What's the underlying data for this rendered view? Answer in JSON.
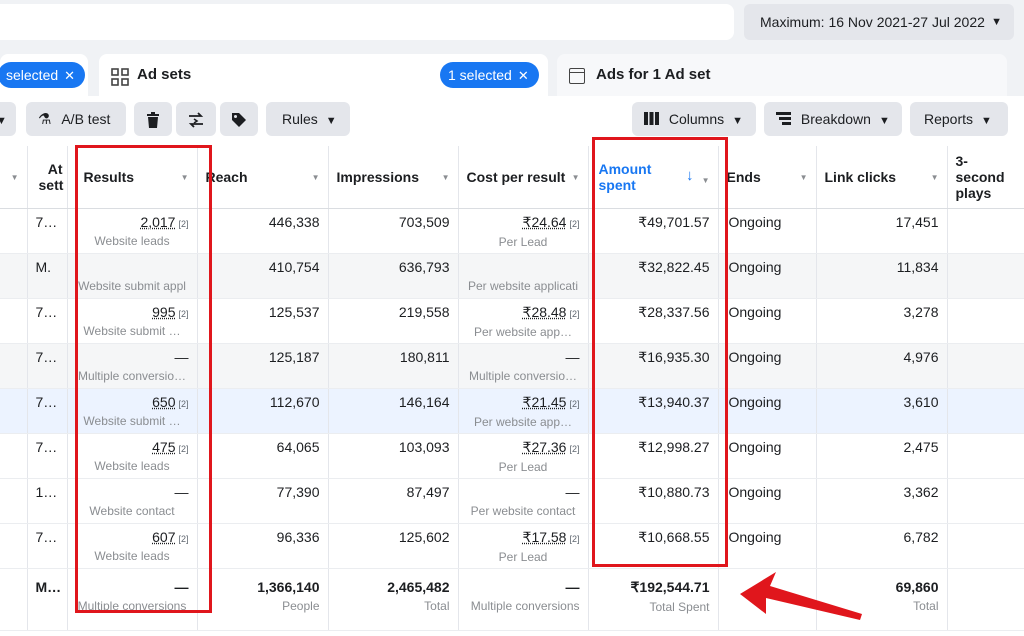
{
  "topbar": {
    "date_range": "Maximum: 16 Nov 2021-27 Jul 2022"
  },
  "tabs": {
    "campaigns_selected": "selected",
    "adsets_title": "Ad sets",
    "adsets_selected": "1 selected",
    "ads_title": "Ads for 1 Ad set"
  },
  "toolbar": {
    "ab_test": "A/B test",
    "rules": "Rules",
    "columns": "Columns",
    "breakdown": "Breakdown",
    "reports": "Reports"
  },
  "table": {
    "headers": {
      "attr": "Attribution setting",
      "attr_short": "At sett",
      "results": "Results",
      "reach": "Reach",
      "impressions": "Impressions",
      "cost": "Cost per result",
      "amount": "Amount spent",
      "ends": "Ends",
      "link_clicks": "Link clicks",
      "plays": "3-second plays"
    },
    "rows": [
      {
        "attr": "7…",
        "results": "2,017",
        "results_sub": "Website leads",
        "reach": "446,338",
        "impressions": "703,509",
        "cost": "₹24.64",
        "cost_sub": "Per Lead",
        "amount": "₹49,701.57",
        "ends": "Ongoing",
        "clicks": "17,451"
      },
      {
        "attr": "M.",
        "results": "",
        "results_sub": "Website submit appl",
        "reach": "410,754",
        "impressions": "636,793",
        "cost": "",
        "cost_sub": "Per website applicati",
        "amount": "₹32,822.45",
        "ends": "Ongoing",
        "clicks": "11,834"
      },
      {
        "attr": "7…",
        "results": "995",
        "results_sub": "Website submit …",
        "reach": "125,537",
        "impressions": "219,558",
        "cost": "₹28.48",
        "cost_sub": "Per website app…",
        "amount": "₹28,337.56",
        "ends": "Ongoing",
        "clicks": "3,278"
      },
      {
        "attr": "7…",
        "results": "—",
        "results_sub": "Multiple conversio…",
        "reach": "125,187",
        "impressions": "180,811",
        "cost": "—",
        "cost_sub": "Multiple conversio…",
        "amount": "₹16,935.30",
        "ends": "Ongoing",
        "clicks": "4,976"
      },
      {
        "attr": "7…",
        "results": "650",
        "results_sub": "Website submit …",
        "reach": "112,670",
        "impressions": "146,164",
        "cost": "₹21.45",
        "cost_sub": "Per website app…",
        "amount": "₹13,940.37",
        "ends": "Ongoing",
        "clicks": "3,610"
      },
      {
        "attr": "7…",
        "results": "475",
        "results_sub": "Website leads",
        "reach": "64,065",
        "impressions": "103,093",
        "cost": "₹27.36",
        "cost_sub": "Per Lead",
        "amount": "₹12,998.27",
        "ends": "Ongoing",
        "clicks": "2,475"
      },
      {
        "attr": "1…",
        "results": "—",
        "results_sub": "Website contact",
        "reach": "77,390",
        "impressions": "87,497",
        "cost": "—",
        "cost_sub": "Per website contact",
        "amount": "₹10,880.73",
        "ends": "Ongoing",
        "clicks": "3,362"
      },
      {
        "attr": "7…",
        "results": "607",
        "results_sub": "Website leads",
        "reach": "96,336",
        "impressions": "125,602",
        "cost": "₹17.58",
        "cost_sub": "Per Lead",
        "amount": "₹10,668.55",
        "ends": "Ongoing",
        "clicks": "6,782"
      }
    ],
    "sup_label": "[2]",
    "totals": {
      "attr": "M…",
      "results": "—",
      "results_sub": "Multiple conversions",
      "reach": "1,366,140",
      "reach_sub": "People",
      "impressions": "2,465,482",
      "impressions_sub": "Total",
      "cost": "—",
      "cost_sub": "Multiple conversions",
      "amount": "₹192,544.71",
      "amount_sub": "Total Spent",
      "clicks": "69,860",
      "clicks_sub": "Total"
    }
  },
  "colors": {
    "accent": "#1877f2",
    "annotation": "#e0161c"
  }
}
